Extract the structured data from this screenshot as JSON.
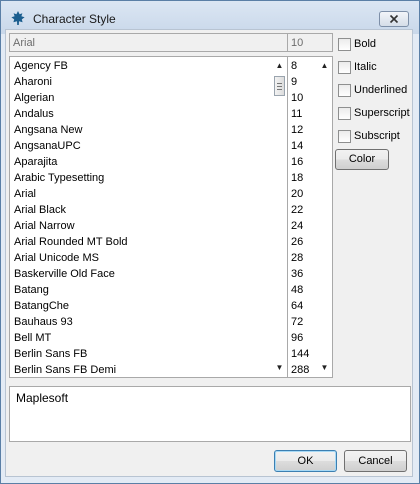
{
  "window": {
    "title": "Character Style"
  },
  "font_name_field": {
    "value": "Arial"
  },
  "font_size_field": {
    "value": "10"
  },
  "font_list": [
    "Agency FB",
    "Aharoni",
    "Algerian",
    "Andalus",
    "Angsana New",
    "AngsanaUPC",
    "Aparajita",
    "Arabic Typesetting",
    "Arial",
    "Arial Black",
    "Arial Narrow",
    "Arial Rounded MT Bold",
    "Arial Unicode MS",
    "Baskerville Old Face",
    "Batang",
    "BatangChe",
    "Bauhaus 93",
    "Bell MT",
    "Berlin Sans FB",
    "Berlin Sans FB Demi"
  ],
  "size_list": [
    "8",
    "9",
    "10",
    "11",
    "12",
    "14",
    "16",
    "18",
    "20",
    "22",
    "24",
    "26",
    "28",
    "36",
    "48",
    "64",
    "72",
    "96",
    "144",
    "288"
  ],
  "styles": [
    {
      "label": "Bold",
      "checked": false
    },
    {
      "label": "Italic",
      "checked": false
    },
    {
      "label": "Underlined",
      "checked": false
    },
    {
      "label": "Superscript",
      "checked": false
    },
    {
      "label": "Subscript",
      "checked": false
    }
  ],
  "buttons": {
    "color": "Color",
    "ok": "OK",
    "cancel": "Cancel"
  },
  "preview": {
    "text": "Maplesoft"
  },
  "colors": {
    "title_bar": "#cfdcec",
    "client": "#f0f0f0"
  },
  "icons": {
    "app": "maple-leaf-icon",
    "close": "close-icon",
    "scroll_up": "scroll-up-icon",
    "scroll_down": "scroll-down-icon"
  }
}
